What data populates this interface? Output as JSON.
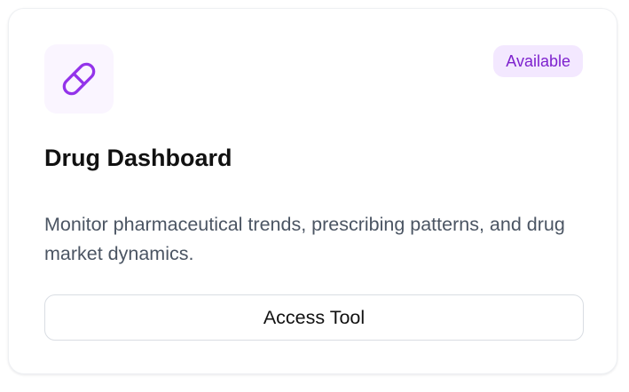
{
  "tool_card": {
    "icon": "pill-icon",
    "status_badge": "Available",
    "title": "Drug Dashboard",
    "description": "Monitor pharmaceutical trends, prescribing patterns, and drug market dynamics.",
    "button_label": "Access Tool"
  },
  "colors": {
    "accent": "#9333ea",
    "badge_background": "#f3e8ff",
    "badge_text": "#7e22ce",
    "icon_tile_background": "#faf5ff",
    "title_text": "#111111",
    "body_text": "#4b5563",
    "border": "#d9dde3"
  }
}
